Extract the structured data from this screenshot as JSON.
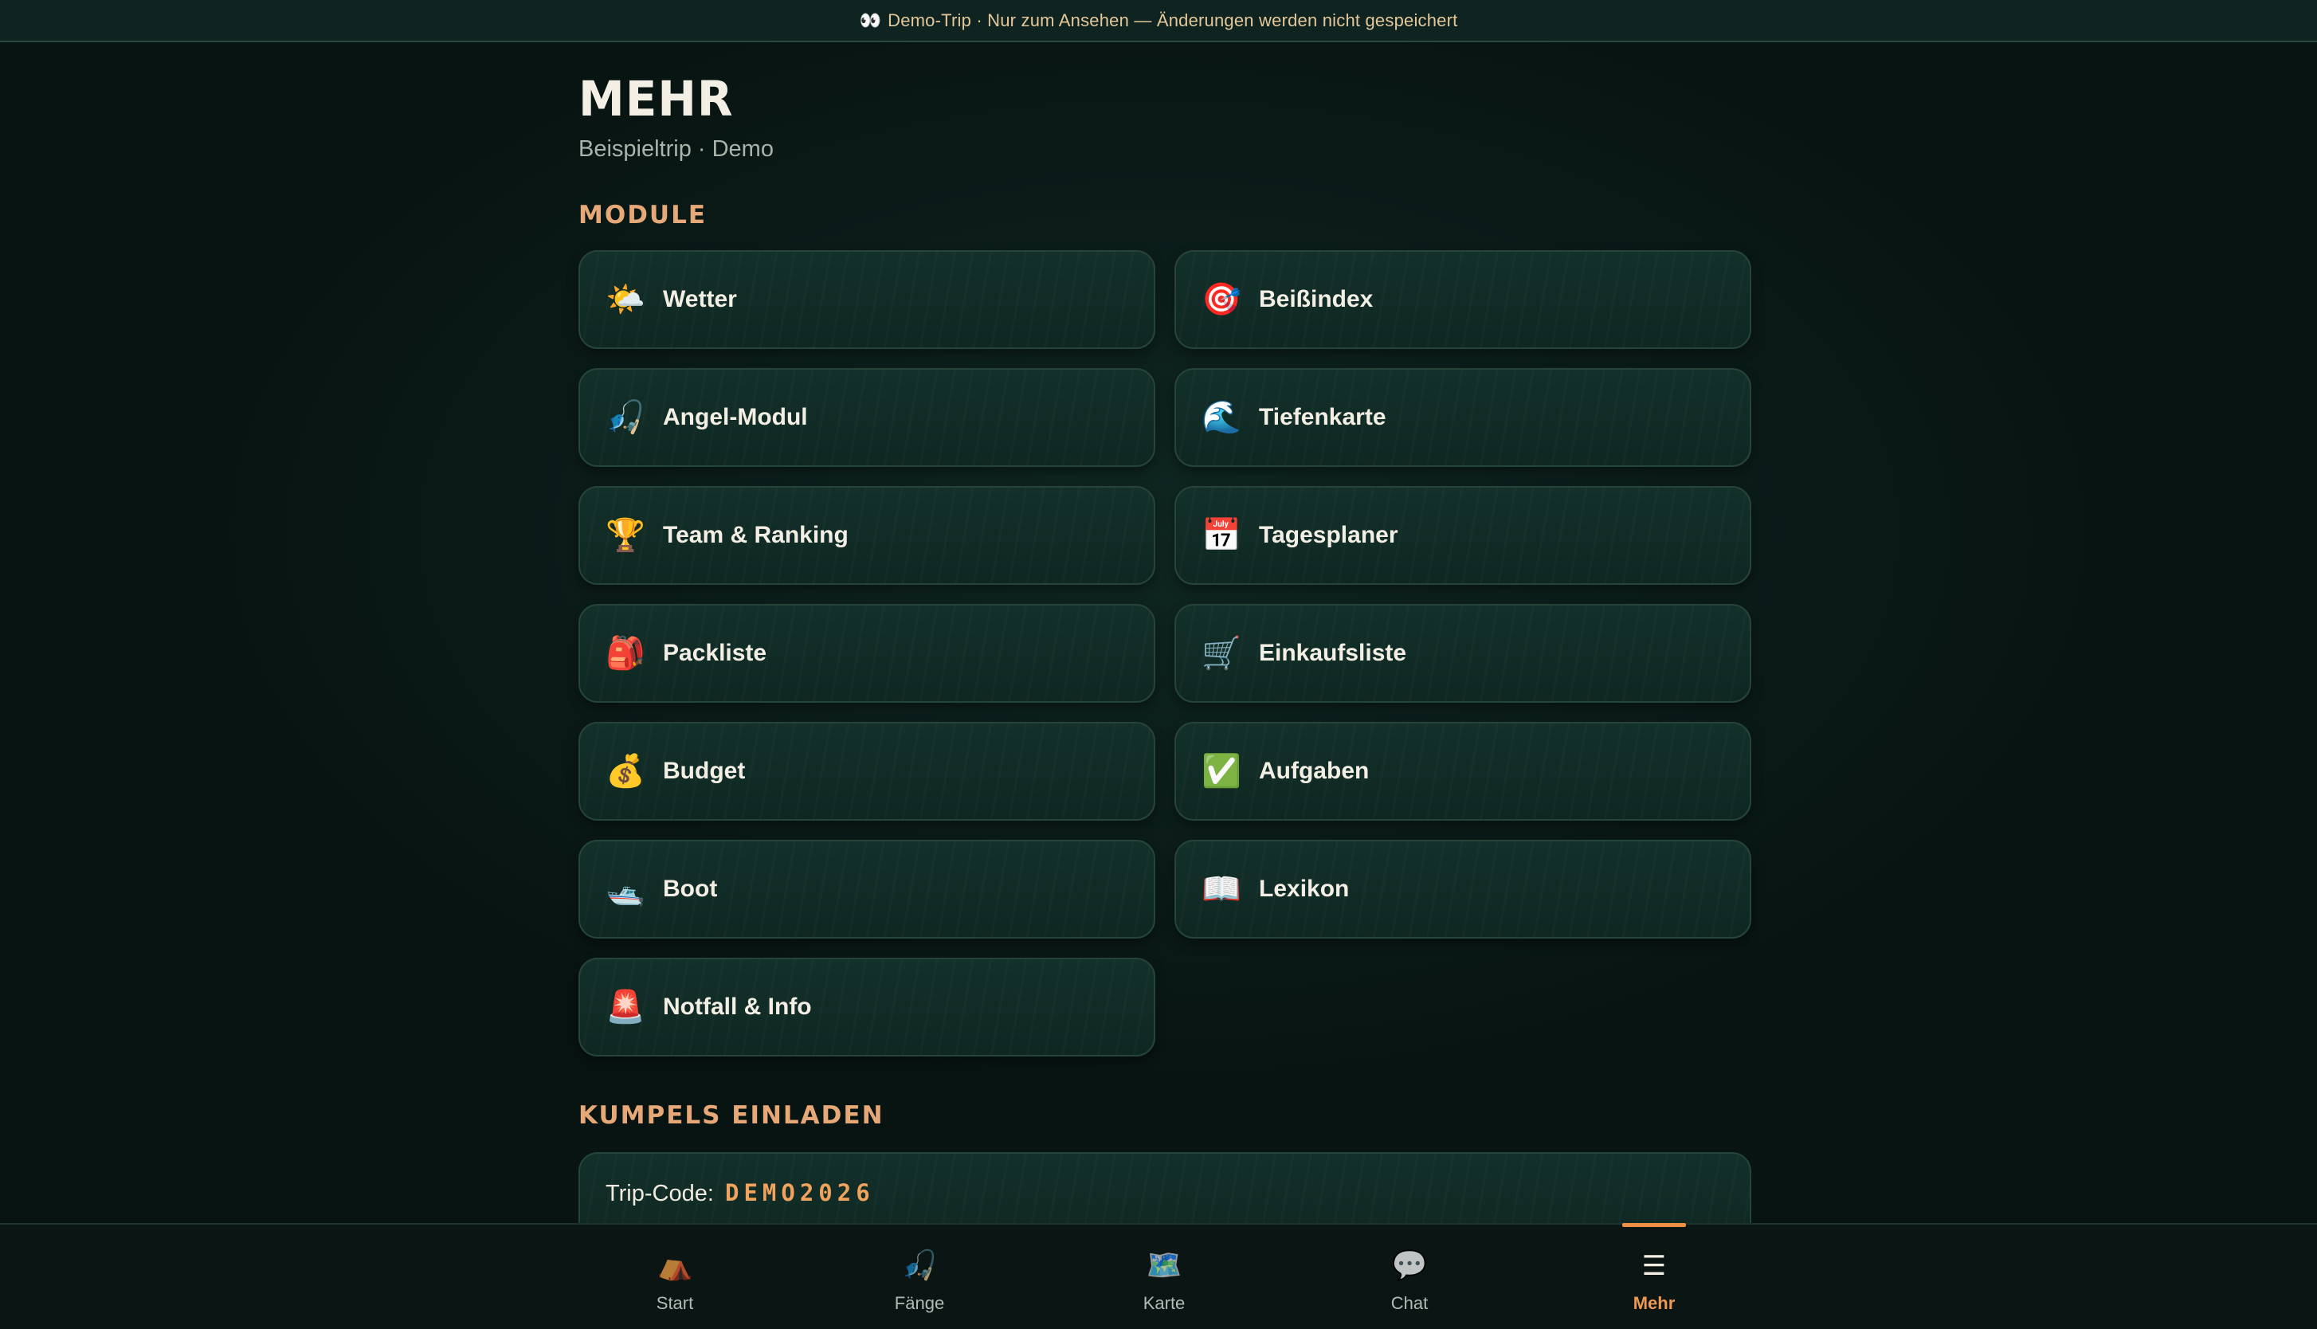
{
  "banner": {
    "icon": "eyes-icon",
    "text": "Demo-Trip · Nur zum Ansehen — Änderungen werden nicht gespeichert"
  },
  "header": {
    "title": "MEHR",
    "subtitle": "Beispieltrip · Demo"
  },
  "modules": {
    "title": "MODULE",
    "items": [
      {
        "label": "Wetter",
        "icon": "sun-behind-cloud-icon",
        "glyph": "🌤️"
      },
      {
        "label": "Beißindex",
        "icon": "target-icon",
        "glyph": "🎯"
      },
      {
        "label": "Angel-Modul",
        "icon": "fishing-rod-icon",
        "glyph": "🎣"
      },
      {
        "label": "Tiefenkarte",
        "icon": "wave-icon",
        "glyph": "🌊"
      },
      {
        "label": "Team & Ranking",
        "icon": "trophy-icon",
        "glyph": "🏆"
      },
      {
        "label": "Tagesplaner",
        "icon": "calendar-icon",
        "glyph": "📅"
      },
      {
        "label": "Packliste",
        "icon": "backpack-icon",
        "glyph": "🎒"
      },
      {
        "label": "Einkaufsliste",
        "icon": "shopping-cart-icon",
        "glyph": "🛒"
      },
      {
        "label": "Budget",
        "icon": "money-bag-icon",
        "glyph": "💰"
      },
      {
        "label": "Aufgaben",
        "icon": "check-mark-icon",
        "glyph": "✅"
      },
      {
        "label": "Boot",
        "icon": "boat-icon",
        "glyph": "🛥️"
      },
      {
        "label": "Lexikon",
        "icon": "book-icon",
        "glyph": "📖"
      },
      {
        "label": "Notfall & Info",
        "icon": "siren-icon",
        "glyph": "🚨"
      }
    ]
  },
  "invite": {
    "title": "KUMPELS EINLADEN",
    "trip_code_label": "Trip-Code:",
    "trip_code": "DEMO2026"
  },
  "nav": {
    "items": [
      {
        "label": "Start",
        "icon": "tent-icon",
        "glyph": "⛺"
      },
      {
        "label": "Fänge",
        "icon": "fishing-rod-icon",
        "glyph": "🎣"
      },
      {
        "label": "Karte",
        "icon": "map-icon",
        "glyph": "🗺️"
      },
      {
        "label": "Chat",
        "icon": "speech-bubble-icon",
        "glyph": "💬"
      },
      {
        "label": "Mehr",
        "icon": "hamburger-menu-icon",
        "glyph": "☰"
      }
    ],
    "active": "Mehr"
  },
  "colors": {
    "accent": "#ef8f45",
    "section_title": "#e5a876",
    "background": "#0b1c19",
    "card": "#12302a"
  }
}
